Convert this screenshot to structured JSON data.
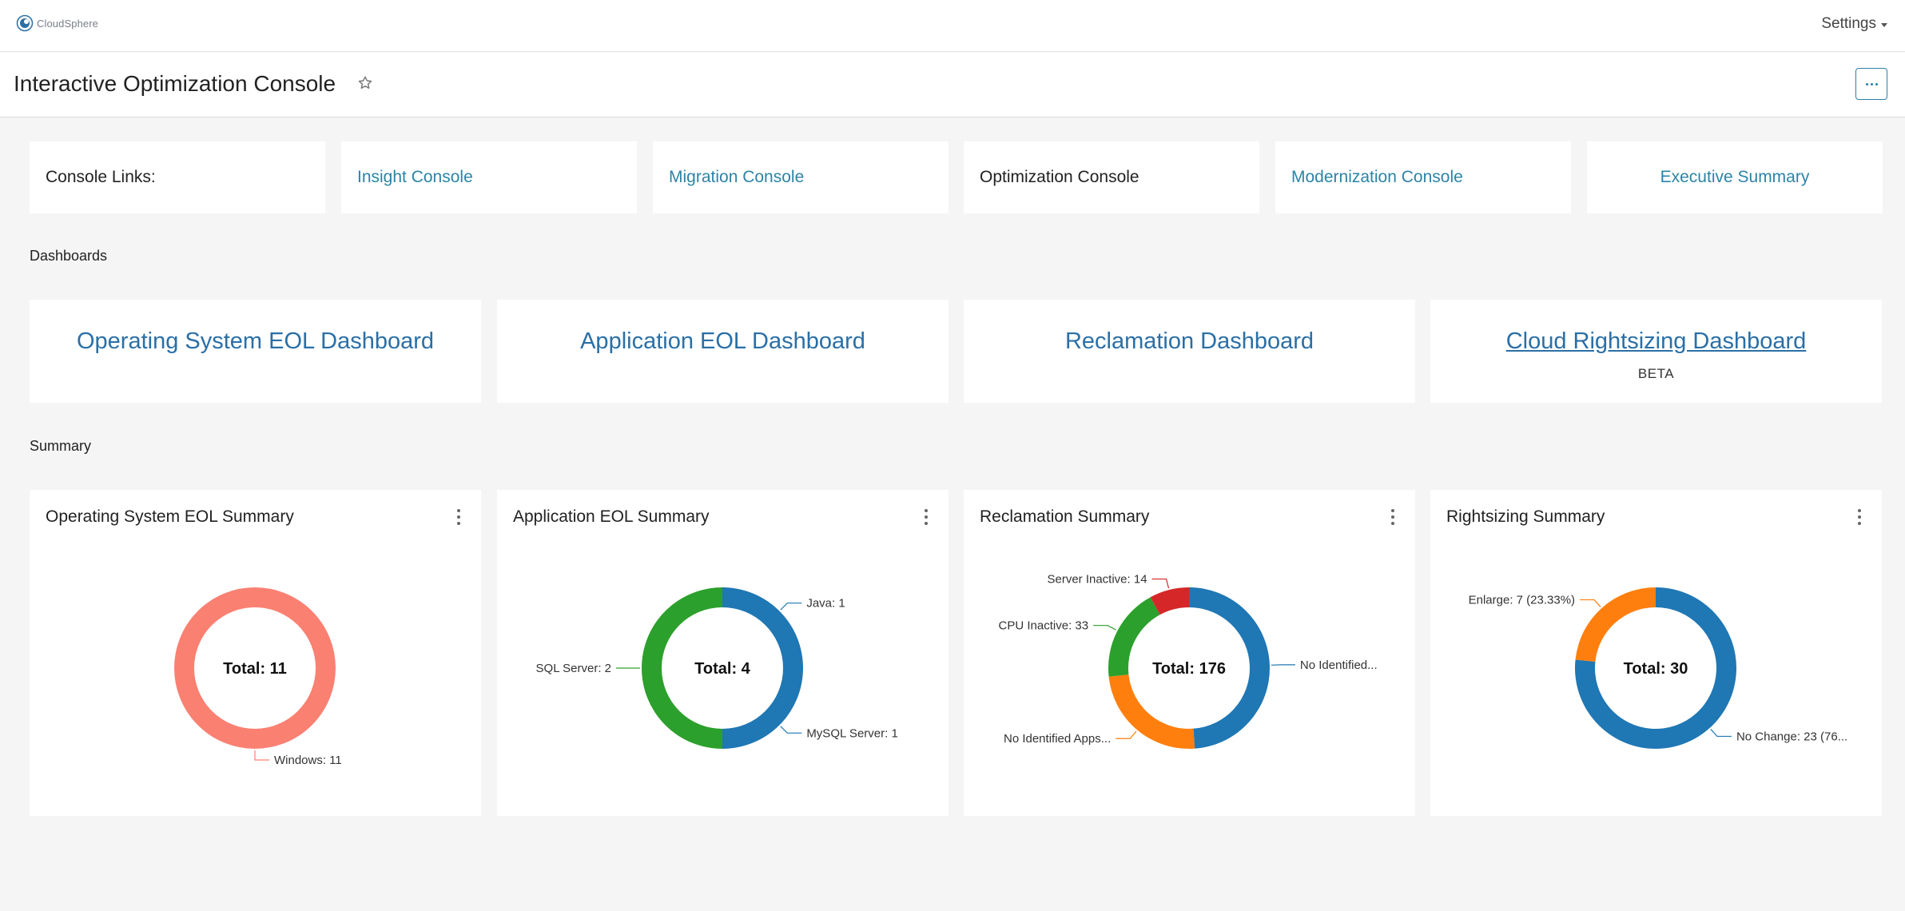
{
  "header": {
    "logo_text": "CloudSphere",
    "settings_label": "Settings"
  },
  "page": {
    "title": "Interactive Optimization Console"
  },
  "console_links": {
    "label": "Console Links:",
    "items": [
      {
        "label": "Insight Console",
        "is_link": true
      },
      {
        "label": "Migration Console",
        "is_link": true
      },
      {
        "label": "Optimization Console",
        "is_link": false
      },
      {
        "label": "Modernization Console",
        "is_link": true
      },
      {
        "label": "Executive Summary",
        "is_link": true
      }
    ]
  },
  "dashboards": {
    "heading": "Dashboards",
    "items": [
      {
        "label": "Operating System EOL Dashboard"
      },
      {
        "label": "Application EOL Dashboard"
      },
      {
        "label": "Reclamation Dashboard"
      },
      {
        "label": "Cloud Rightsizing Dashboard",
        "badge": "BETA"
      }
    ]
  },
  "summary": {
    "heading": "Summary"
  },
  "colors": {
    "link": "#2c84a6",
    "dashboard_link": "#2a6fa6",
    "salmon": "#fa8072",
    "blue": "#1f77b4",
    "green": "#2ca02c",
    "orange": "#ff7f0e",
    "red": "#d62728"
  },
  "chart_data": [
    {
      "type": "pie",
      "title": "Operating System EOL Summary",
      "center_label": "Total: 11",
      "slices": [
        {
          "label": "Windows: 11",
          "value": 11,
          "color": "#fa8072"
        }
      ]
    },
    {
      "type": "pie",
      "title": "Application EOL Summary",
      "center_label": "Total: 4",
      "slices": [
        {
          "label": "Java: 1",
          "value": 1,
          "color": "#1f77b4"
        },
        {
          "label": "MySQL Server: 1",
          "value": 1,
          "color": "#1f77b4"
        },
        {
          "label": "SQL Server: 2",
          "value": 2,
          "color": "#2ca02c"
        }
      ]
    },
    {
      "type": "pie",
      "title": "Reclamation Summary",
      "center_label": "Total: 176",
      "slices": [
        {
          "label": "No Identified...",
          "value": 86,
          "color": "#1f77b4"
        },
        {
          "label": "No Identified Apps...",
          "value": 43,
          "color": "#ff7f0e"
        },
        {
          "label": "CPU Inactive: 33",
          "value": 33,
          "color": "#2ca02c"
        },
        {
          "label": "Server Inactive: 14",
          "value": 14,
          "color": "#d62728"
        }
      ]
    },
    {
      "type": "pie",
      "title": "Rightsizing Summary",
      "center_label": "Total: 30",
      "slices": [
        {
          "label": "No Change: 23 (76...",
          "value": 23,
          "color": "#1f77b4"
        },
        {
          "label": "Enlarge: 7 (23.33%)",
          "value": 7,
          "color": "#ff7f0e"
        }
      ]
    }
  ]
}
